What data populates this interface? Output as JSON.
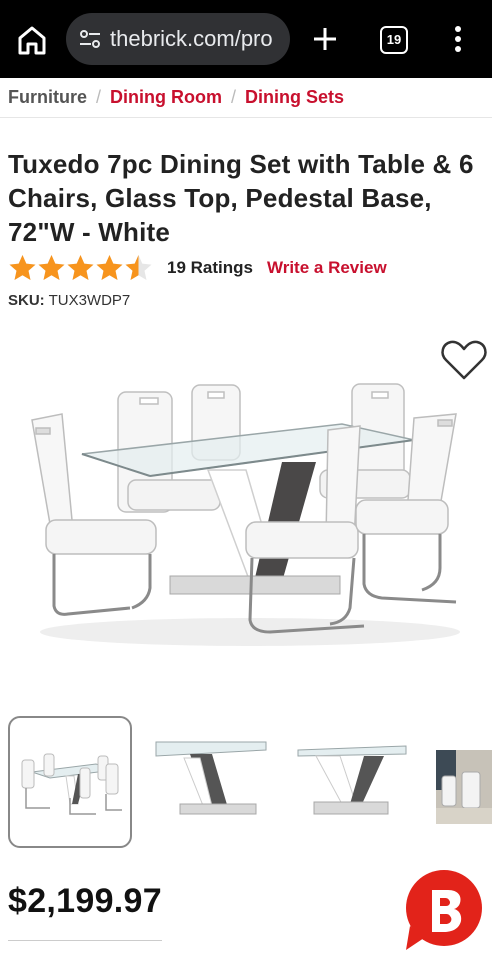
{
  "browser": {
    "url": "thebrick.com/pro",
    "tab_count": "19",
    "icons": [
      "home-icon",
      "site-settings-icon",
      "new-tab-icon",
      "tab-switcher-icon",
      "overflow-menu-icon"
    ]
  },
  "breadcrumb": {
    "items": [
      "Furniture",
      "Dining Room",
      "Dining Sets"
    ],
    "separator": "/"
  },
  "product": {
    "title": "Tuxedo 7pc Dining Set with Table & 6 Chairs, Glass Top, Pedestal Base, 72\"W - White",
    "rating": 4.5,
    "rating_max": 5,
    "ratings_count": "19 Ratings",
    "write_review": "Write a Review",
    "sku_label": "SKU:",
    "sku_value": "TUX3WDP7",
    "price": "$2,199.97",
    "thumbnail_count": 4,
    "active_thumbnail": 1
  },
  "colors": {
    "brand_red": "#c8102e",
    "star_orange": "#f7941d",
    "text_dark": "#222222"
  }
}
